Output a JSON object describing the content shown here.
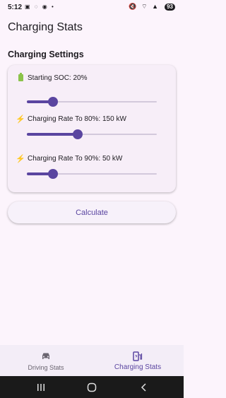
{
  "status_bar": {
    "time": "5:12",
    "left_icons": "▣ ◌ ◉ •",
    "right_icons": "🔇 ⌔ ▲",
    "battery": "93"
  },
  "app": {
    "title": "Charging Stats"
  },
  "section": {
    "title": "Charging Settings"
  },
  "settings": [
    {
      "label": "Starting SOC: 20%",
      "icon": "battery-icon",
      "value_percent": 20
    },
    {
      "label": "Charging Rate To 80%: 150 kW",
      "icon": "lightning-icon",
      "value_percent": 39
    },
    {
      "label": "Charging Rate To 90%: 50 kW",
      "icon": "lightning-icon",
      "value_percent": 20
    }
  ],
  "calculate_button": {
    "label": "Calculate"
  },
  "bottom_nav": {
    "items": [
      {
        "label": "Driving Stats",
        "icon": "car-icon",
        "active": false
      },
      {
        "label": "Charging Stats",
        "icon": "ev-station-icon",
        "active": true
      }
    ]
  },
  "colors": {
    "accent": "#5a45a0",
    "background": "#fcf4fc",
    "card": "#f7eef8",
    "bolt": "#f2b134",
    "battery_icon": "#8bc34a"
  }
}
